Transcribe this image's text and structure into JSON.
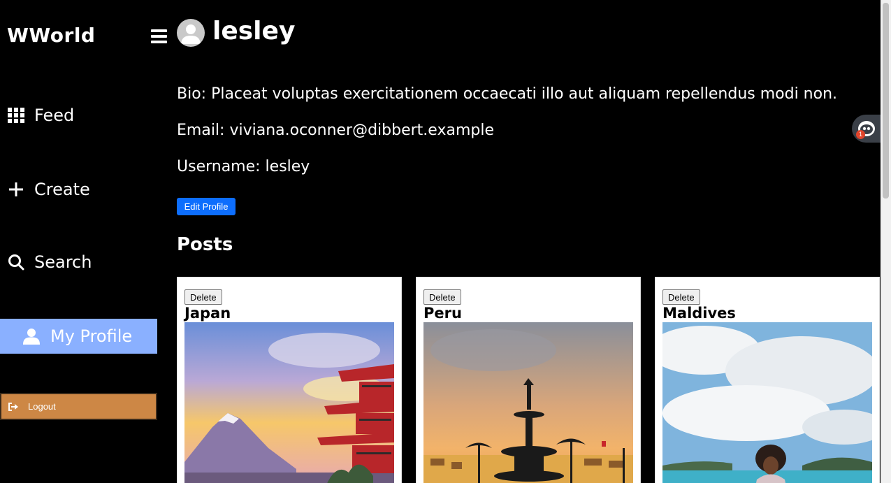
{
  "app": {
    "brand": "WWorld"
  },
  "sidebar": {
    "items": [
      {
        "label": "Feed",
        "icon": "grid-icon",
        "active": false
      },
      {
        "label": "Create",
        "icon": "plus-icon",
        "active": false
      },
      {
        "label": "Search",
        "icon": "search-icon",
        "active": false
      },
      {
        "label": "My Profile",
        "icon": "user-icon",
        "active": true
      }
    ],
    "logout_label": "Logout",
    "active_color": "#8ab0ff",
    "logout_color": "#cd8745"
  },
  "profile": {
    "name": "lesley",
    "bio": "Bio: Placeat voluptas exercitationem occaecati illo aut aliquam repellendus modi non.",
    "email": "Email: viviana.oconner@dibbert.example",
    "username": "Username: lesley",
    "edit_label": "Edit Profile",
    "edit_color": "#0d6efd"
  },
  "posts": {
    "title": "Posts",
    "items": [
      {
        "title": "Japan",
        "delete_label": "Delete"
      },
      {
        "title": "Peru",
        "delete_label": "Delete"
      },
      {
        "title": "Maldives",
        "delete_label": "Delete"
      }
    ]
  },
  "widget": {
    "badge": "1"
  }
}
